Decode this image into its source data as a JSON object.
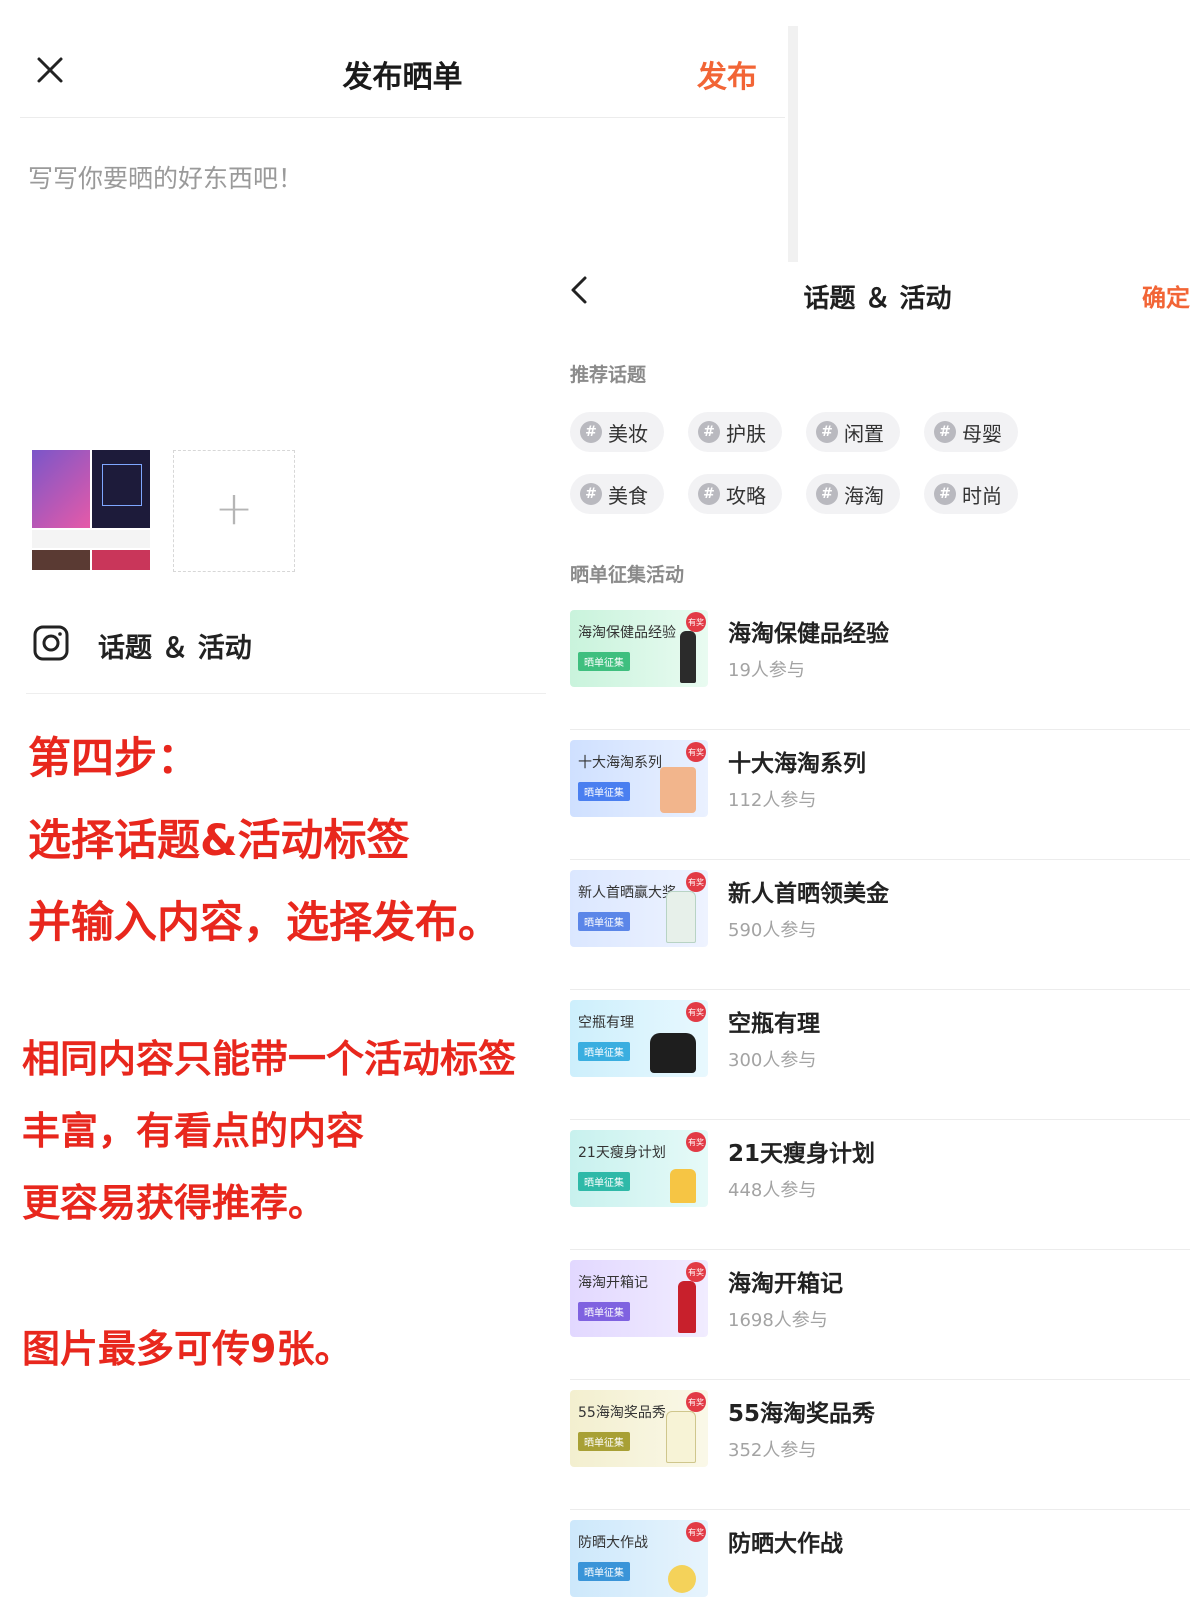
{
  "left": {
    "title": "发布晒单",
    "publish_label": "发布",
    "content_placeholder": "写写你要晒的好东西吧！",
    "add_image_symbol": "+",
    "topic_label": "话题 ＆ 活动"
  },
  "notes": {
    "step_line1": "第四步：",
    "step_line2": "选择话题&活动标签",
    "step_line3": "并输入内容，选择发布。",
    "tip_line1": "相同内容只能带一个活动标签",
    "tip_line2": "丰富，有看点的内容",
    "tip_line3": "更容易获得推荐。",
    "tip_line4": "图片最多可传9张。"
  },
  "right": {
    "title": "话题 ＆ 活动",
    "confirm_label": "确定",
    "recommended_label": "推荐话题",
    "activity_section_label": "晒单征集活动",
    "tags": [
      {
        "label": "美妆"
      },
      {
        "label": "护肤"
      },
      {
        "label": "闲置"
      },
      {
        "label": "母婴"
      },
      {
        "label": "美食"
      },
      {
        "label": "攻略"
      },
      {
        "label": "海淘"
      },
      {
        "label": "时尚"
      }
    ],
    "activities": [
      {
        "thumb_text": "海淘保健品经验",
        "chip": "晒单征集",
        "award": "有奖",
        "title": "海淘保健品经验",
        "count": "19人参与"
      },
      {
        "thumb_text": "十大海淘系列",
        "chip": "晒单征集",
        "award": "有奖",
        "title": "十大海淘系列",
        "count": "112人参与"
      },
      {
        "thumb_text": "新人首晒赢大奖",
        "chip": "晒单征集",
        "award": "有奖",
        "title": "新人首晒领美金",
        "count": "590人参与"
      },
      {
        "thumb_text": "空瓶有理",
        "chip": "晒单征集",
        "award": "有奖",
        "title": "空瓶有理",
        "count": "300人参与"
      },
      {
        "thumb_text": "21天瘦身计划",
        "chip": "晒单征集",
        "award": "有奖",
        "title": "21天瘦身计划",
        "count": "448人参与"
      },
      {
        "thumb_text": "海淘开箱记",
        "chip": "晒单征集",
        "award": "有奖",
        "title": "海淘开箱记",
        "count": "1698人参与"
      },
      {
        "thumb_text": "55海淘奖品秀",
        "chip": "晒单征集",
        "award": "有奖",
        "title": "55海淘奖品秀",
        "count": "352人参与"
      },
      {
        "thumb_text": "防晒大作战",
        "chip": "晒单征集",
        "award": "有奖",
        "title": "防晒大作战",
        "count": ""
      }
    ]
  },
  "colors": {
    "accent": "#f26536",
    "note_red": "#e8271d"
  }
}
